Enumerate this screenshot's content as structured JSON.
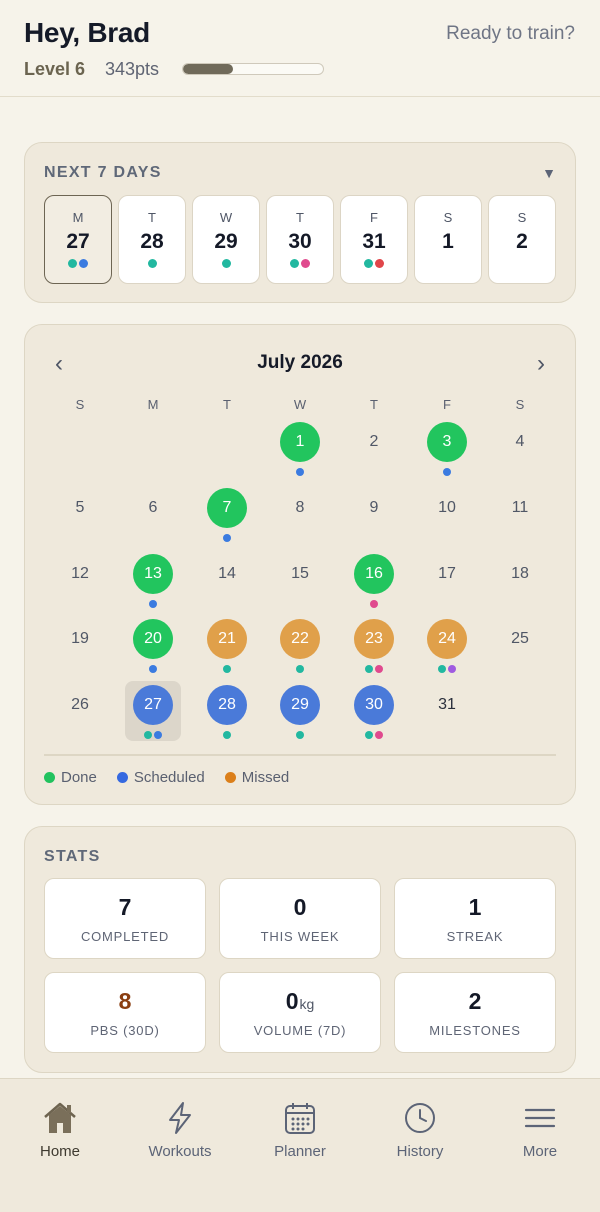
{
  "header": {
    "greeting": "Hey, Brad",
    "tagline": "Ready to train?",
    "level": "Level 6",
    "points": "343pts",
    "level_progress": 0.36
  },
  "next7": {
    "title": "NEXT 7 DAYS",
    "toggle_icon": "caret-down-icon",
    "days": [
      {
        "letter": "M",
        "num": "27",
        "dots": [
          "#22b8a0",
          "#3b7be0"
        ],
        "selected": true
      },
      {
        "letter": "T",
        "num": "28",
        "dots": [
          "#22b8a0"
        ]
      },
      {
        "letter": "W",
        "num": "29",
        "dots": [
          "#22b8a0"
        ]
      },
      {
        "letter": "T",
        "num": "30",
        "dots": [
          "#22b8a0",
          "#e04a8e"
        ]
      },
      {
        "letter": "F",
        "num": "31",
        "dots": [
          "#22b8a0",
          "#e0464a"
        ]
      },
      {
        "letter": "S",
        "num": "1",
        "dots": []
      },
      {
        "letter": "S",
        "num": "2",
        "dots": []
      }
    ]
  },
  "calendar": {
    "month": "July 2026",
    "prev_icon": "chevron-left-icon",
    "next_icon": "chevron-right-icon",
    "weekdays": [
      "S",
      "M",
      "T",
      "W",
      "T",
      "F",
      "S"
    ],
    "weeks": [
      [
        null,
        null,
        null,
        {
          "d": "1",
          "s": "done",
          "dots": [
            "#3b7be0"
          ]
        },
        {
          "d": "2"
        },
        {
          "d": "3",
          "s": "done",
          "dots": [
            "#3b7be0"
          ]
        },
        {
          "d": "4"
        }
      ],
      [
        {
          "d": "5"
        },
        {
          "d": "6"
        },
        {
          "d": "7",
          "s": "done",
          "dots": [
            "#3b7be0"
          ]
        },
        {
          "d": "8"
        },
        {
          "d": "9"
        },
        {
          "d": "10"
        },
        {
          "d": "11"
        }
      ],
      [
        {
          "d": "12"
        },
        {
          "d": "13",
          "s": "done",
          "dots": [
            "#3b7be0"
          ]
        },
        {
          "d": "14"
        },
        {
          "d": "15"
        },
        {
          "d": "16",
          "s": "done",
          "dots": [
            "#e04a8e"
          ]
        },
        {
          "d": "17"
        },
        {
          "d": "18"
        }
      ],
      [
        {
          "d": "19"
        },
        {
          "d": "20",
          "s": "done",
          "dots": [
            "#3b7be0"
          ]
        },
        {
          "d": "21",
          "s": "missed",
          "dots": [
            "#22b8a0"
          ]
        },
        {
          "d": "22",
          "s": "missed",
          "dots": [
            "#22b8a0"
          ]
        },
        {
          "d": "23",
          "s": "missed",
          "dots": [
            "#22b8a0",
            "#e04a8e"
          ]
        },
        {
          "d": "24",
          "s": "missed",
          "dots": [
            "#22b8a0",
            "#a05be0"
          ]
        },
        {
          "d": "25"
        }
      ],
      [
        {
          "d": "26"
        },
        {
          "d": "27",
          "s": "scheduled",
          "today": true,
          "dots": [
            "#22b8a0",
            "#3b7be0"
          ]
        },
        {
          "d": "28",
          "s": "scheduled",
          "dots": [
            "#22b8a0"
          ]
        },
        {
          "d": "29",
          "s": "scheduled",
          "dots": [
            "#22b8a0"
          ]
        },
        {
          "d": "30",
          "s": "scheduled",
          "dots": [
            "#22b8a0",
            "#e04a8e"
          ]
        },
        {
          "d": "31",
          "dark": true
        },
        null
      ]
    ],
    "legend": [
      {
        "label": "Done",
        "color": "#21c25e"
      },
      {
        "label": "Scheduled",
        "color": "#3569e0"
      },
      {
        "label": "Missed",
        "color": "#db7f1a"
      }
    ],
    "status_colors": {
      "done": "#22c55e",
      "scheduled": "#4a7ad9",
      "missed": "#e0a04a"
    }
  },
  "stats": {
    "title": "STATS",
    "items": [
      {
        "value": "7",
        "label": "COMPLETED"
      },
      {
        "value": "0",
        "label": "THIS WEEK"
      },
      {
        "value": "1",
        "label": "STREAK"
      },
      {
        "value": "8",
        "label": "PBS (30D)",
        "accent": true
      },
      {
        "value": "0",
        "unit": "kg",
        "label": "VOLUME (7D)"
      },
      {
        "value": "2",
        "label": "MILESTONES"
      }
    ]
  },
  "tabbar": {
    "tabs": [
      {
        "label": "Home",
        "icon": "home-icon",
        "active": true
      },
      {
        "label": "Workouts",
        "icon": "lightning-icon"
      },
      {
        "label": "Planner",
        "icon": "calendar-icon"
      },
      {
        "label": "History",
        "icon": "clock-icon"
      },
      {
        "label": "More",
        "icon": "menu-icon"
      }
    ]
  }
}
